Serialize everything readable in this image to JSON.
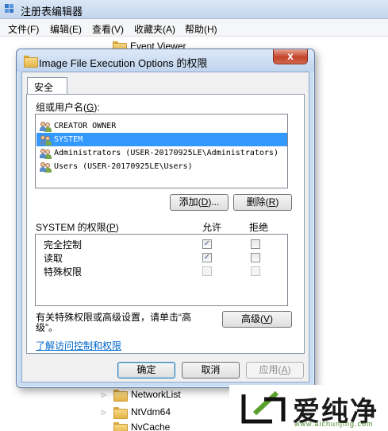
{
  "regedit": {
    "title": "注册表编辑器",
    "menu": [
      "文件(F)",
      "编辑(E)",
      "查看(V)",
      "收藏夹(A)",
      "帮助(H)"
    ],
    "tree_items": [
      "Event Viewer",
      "NetworkList",
      "NtVdm64",
      "NvCache"
    ],
    "icons": {
      "app": "regedit-icon",
      "folder": "folder-icon",
      "expander": "expand-arrow-icon"
    }
  },
  "dialog": {
    "title": "Image File Execution Options 的权限",
    "close_glyph": "x",
    "tab": "安全",
    "group_label_text": "组或用户名",
    "group_label_key": "G",
    "group_label_suffix": ":",
    "users": [
      "CREATOR OWNER",
      "SYSTEM",
      "Administrators (USER-20170925LE\\Administrators)",
      "Users (USER-20170925LE\\Users)"
    ],
    "selected_user": "SYSTEM",
    "add_button": {
      "text": "添加",
      "key": "D",
      "suffix": "..."
    },
    "remove_button": {
      "text": "删除",
      "key": "R"
    },
    "perms_label_text": "SYSTEM 的权限",
    "perms_label_key": "P",
    "allow_header": "允许",
    "deny_header": "拒绝",
    "permissions": [
      {
        "name": "完全控制",
        "allow": true,
        "deny": false,
        "enabled": true
      },
      {
        "name": "读取",
        "allow": true,
        "deny": false,
        "enabled": true
      },
      {
        "name": "特殊权限",
        "allow": false,
        "deny": false,
        "enabled": false
      }
    ],
    "special_note_line1": "有关特殊权限或高级设置，请单击“高",
    "special_note_line2": "级”。",
    "advanced_button": {
      "text": "高级",
      "key": "V"
    },
    "learn_link": "了解访问控制和权限",
    "ok_button": "确定",
    "cancel_button": "取消",
    "apply_button": {
      "text": "应用",
      "key": "A"
    },
    "icons": {
      "title": "folder-icon",
      "user": "users-group-icon",
      "check": "checkmark-icon"
    }
  },
  "watermark": {
    "name": "爱纯净",
    "url": "www.aichunjing.com"
  }
}
